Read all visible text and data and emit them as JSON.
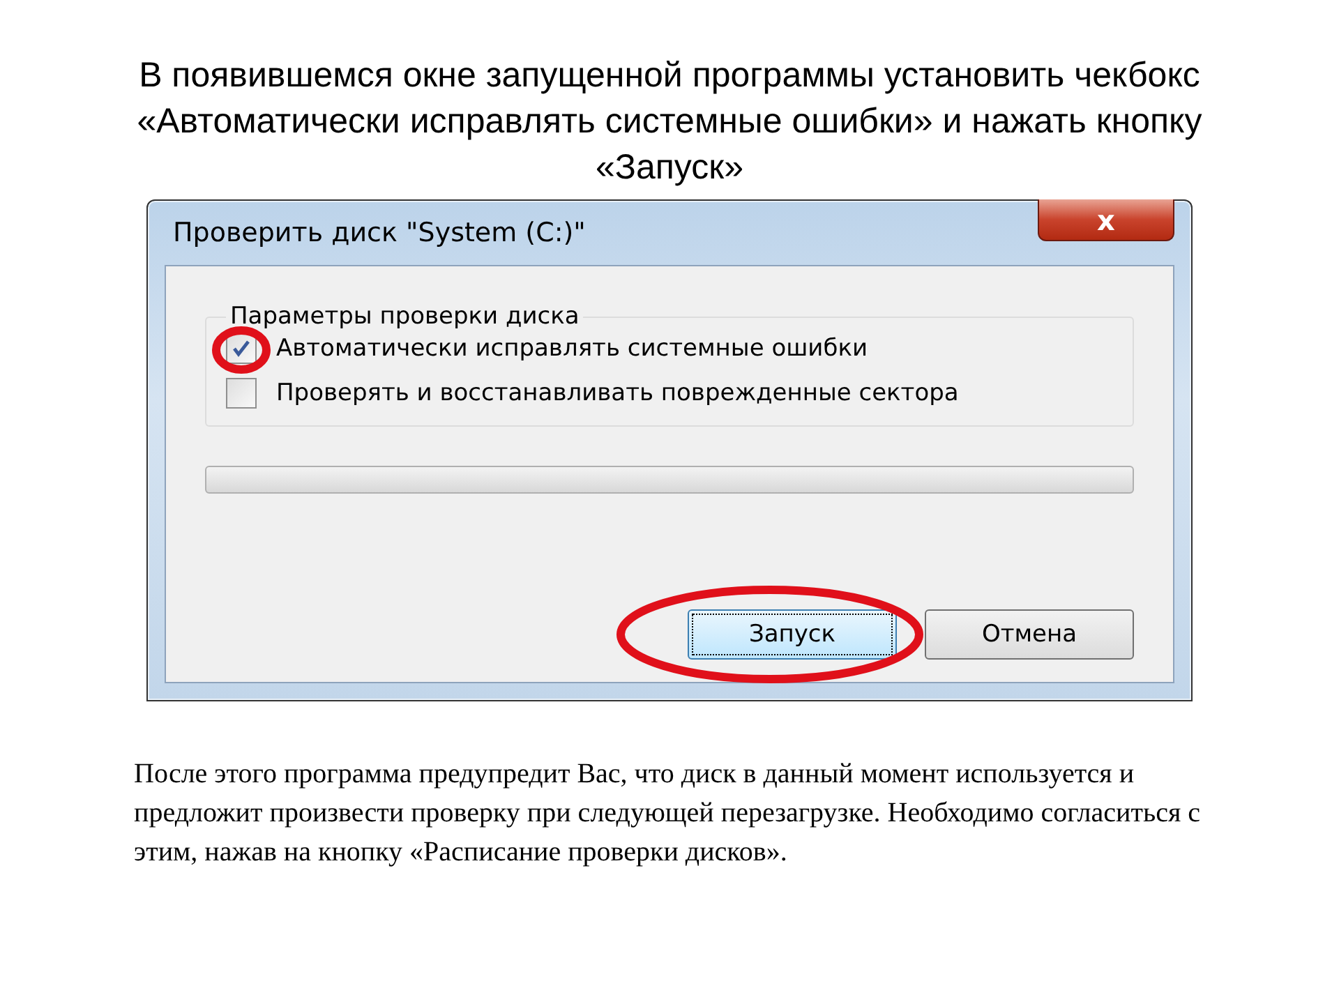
{
  "heading": "В появившемся окне запущенной программы установить чекбокс «Автоматически исправлять системные ошибки» и нажать кнопку «Запуск»",
  "dialog": {
    "title": "Проверить диск \"System (C:)\"",
    "close_label": "x",
    "group": {
      "legend": "Параметры проверки диска",
      "options": [
        {
          "label": "Автоматически исправлять системные ошибки",
          "checked": true,
          "highlighted": true
        },
        {
          "label": "Проверять и восстанавливать поврежденные сектора",
          "checked": false,
          "highlighted": false
        }
      ]
    },
    "progress": {
      "level": 0
    },
    "buttons": [
      {
        "label": "Запуск",
        "default": true,
        "highlighted": true
      },
      {
        "label": "Отмена",
        "default": false,
        "highlighted": false
      }
    ]
  },
  "paragraph": "После этого программа предупредит Вас, что диск в данный момент используется и предложит произвести проверку при следующей перезагрузке. Необходимо согласиться с этим, нажав на кнопку «Расписание проверки дисков»."
}
